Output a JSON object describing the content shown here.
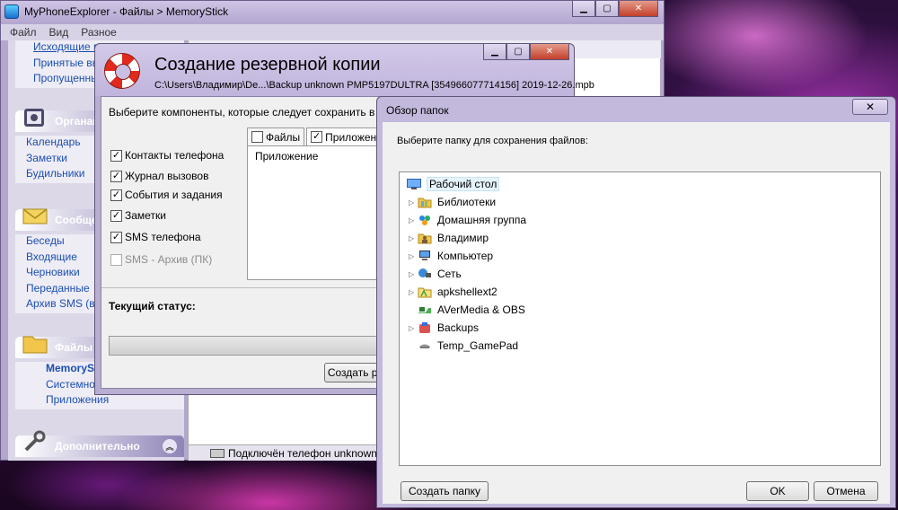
{
  "main_window": {
    "title": "MyPhoneExplorer -  Файлы > MemoryStick",
    "menu": [
      "Файл",
      "Вид",
      "Разное"
    ],
    "sidebar": {
      "calls_items": [
        "Исходящие вызовы",
        "Принятые вызо",
        "Пропущенные"
      ],
      "organizer": {
        "title": "Органайз",
        "items": [
          "Календарь",
          "Заметки",
          "Будильники"
        ]
      },
      "messages": {
        "title": "Сообщен",
        "items": [
          "Беседы",
          "Входящие",
          "Черновики",
          "Переданные",
          "Архив SMS (в П"
        ]
      },
      "files": {
        "title": "Файлы",
        "items": [
          "MemorySt",
          "Системное",
          "Приложения"
        ]
      },
      "extra": {
        "title": "Дополнительно"
      }
    },
    "status_bar": "Подключён телефон unknown P"
  },
  "backup_dialog": {
    "title": "Создание резервной копии",
    "path": "C:\\Users\\Владимир\\De...\\Backup unknown PMP5197DULTRA [354966077714156] 2019-12-26.mpb",
    "hint": "Выберите компоненты, которые следует сохранить в резе",
    "components": [
      {
        "label": "Контакты телефона",
        "checked": true
      },
      {
        "label": "Журнал вызовов",
        "checked": true
      },
      {
        "label": "События и задания",
        "checked": true
      },
      {
        "label": "Заметки",
        "checked": true
      },
      {
        "label": "SMS телефона",
        "checked": true
      },
      {
        "label": "SMS - Архив (ПК)",
        "checked": false,
        "disabled": true
      }
    ],
    "tabs": [
      "Файлы",
      "Приложения"
    ],
    "column_header": "Приложение",
    "status_label": "Текущий статус:",
    "create_button": "Создать ре"
  },
  "folder_dialog": {
    "title": "Обзор папок",
    "close_label": "✕",
    "hint": "Выберите папку для сохранения файлов:",
    "tree": [
      {
        "label": "Рабочий стол",
        "icon": "desktop-icon",
        "expandable": false,
        "selected": true,
        "level": 0
      },
      {
        "label": "Библиотеки",
        "icon": "libraries-icon",
        "expandable": true,
        "level": 1
      },
      {
        "label": "Домашняя группа",
        "icon": "homegroup-icon",
        "expandable": true,
        "level": 1
      },
      {
        "label": "Владимир",
        "icon": "user-folder-icon",
        "expandable": true,
        "level": 1
      },
      {
        "label": "Компьютер",
        "icon": "computer-icon",
        "expandable": true,
        "level": 1
      },
      {
        "label": "Сеть",
        "icon": "network-icon",
        "expandable": true,
        "level": 1
      },
      {
        "label": "apkshellext2",
        "icon": "folder-icon",
        "expandable": true,
        "level": 1
      },
      {
        "label": "AVerMedia & OBS",
        "icon": "shortcut-icon",
        "expandable": false,
        "level": 1
      },
      {
        "label": "Backups",
        "icon": "backups-icon",
        "expandable": true,
        "level": 1
      },
      {
        "label": "Temp_GamePad",
        "icon": "gamepad-icon",
        "expandable": false,
        "level": 1
      }
    ],
    "buttons": {
      "new_folder": "Создать папку",
      "ok": "OK",
      "cancel": "Отмена"
    }
  },
  "colors": {
    "window_frame": "#c3b9dd",
    "link_blue": "#1a4fb0",
    "selection": "#e5f3fb"
  }
}
